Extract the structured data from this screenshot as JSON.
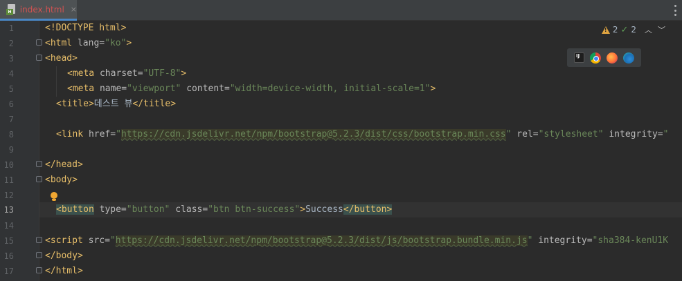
{
  "tab": {
    "title": "index.html",
    "close": "×",
    "icon": "html-file-icon"
  },
  "inspections": {
    "warnings": "2",
    "weak_warnings": "2"
  },
  "browsers": [
    "intellij-icon",
    "chrome-icon",
    "firefox-icon",
    "edge-icon"
  ],
  "line_numbers": [
    "1",
    "2",
    "3",
    "4",
    "5",
    "6",
    "7",
    "8",
    "9",
    "10",
    "11",
    "12",
    "13",
    "14",
    "15",
    "16",
    "17"
  ],
  "current_line": "13",
  "code": {
    "l1_doctype": "<!DOCTYPE html>",
    "l2_open": "<html ",
    "l2_attr": "lang=",
    "l2_val": "\"ko\"",
    "l2_close": ">",
    "l3_tag": "<head>",
    "l4_open": "<meta ",
    "l4_attr": "charset=",
    "l4_val": "\"UTF-8\"",
    "l4_close": ">",
    "l5_open": "<meta ",
    "l5_attr1": "name=",
    "l5_val1": "\"viewport\"",
    "l5_attr2": " content=",
    "l5_val2": "\"width=device-width, initial-scale=1\"",
    "l5_close": ">",
    "l6_open": "<title>",
    "l6_text": "데스트 뷰",
    "l6_close": "</title>",
    "l8_open": "<link ",
    "l8_attr1": "href=",
    "l8_q1": "\"",
    "l8_url": "https://cdn.jsdelivr.net/npm/bootstrap@5.2.3/dist/css/bootstrap.min.css",
    "l8_q2": "\"",
    "l8_attr2": " rel=",
    "l8_val2": "\"stylesheet\"",
    "l8_attr3": " integrity=",
    "l8_val3": "\"",
    "l10_tag": "</head>",
    "l11_tag": "<body>",
    "l13_open": "<button",
    "l13_attr1": " type=",
    "l13_val1": "\"button\"",
    "l13_attr2": " class=",
    "l13_val2": "\"btn btn-success\"",
    "l13_gt": ">",
    "l13_text": "Success",
    "l13_close": "</button>",
    "l15_open": "<script ",
    "l15_attr1": "src=",
    "l15_q1": "\"",
    "l15_url": "https://cdn.jsdelivr.net/npm/bootstrap@5.2.3/dist/js/bootstrap.bundle.min.js",
    "l15_q2": "\"",
    "l15_attr2": " integrity=",
    "l15_val2": "\"sha384-kenU1K",
    "l16_tag": "</body>",
    "l17_tag": "</html>"
  }
}
